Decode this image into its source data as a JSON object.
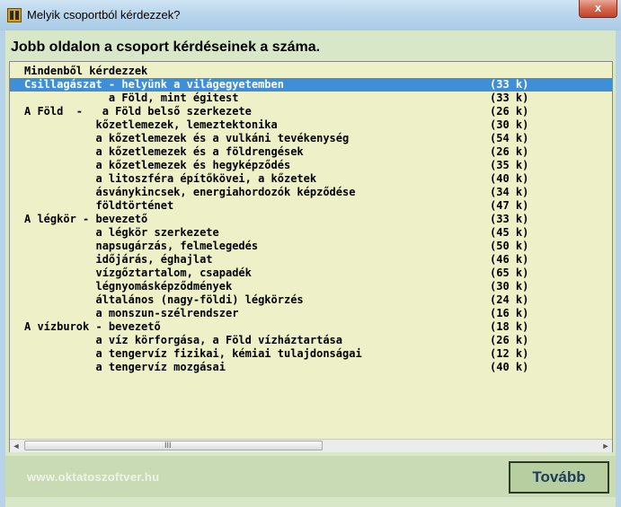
{
  "window": {
    "title": "Melyik csoportból kérdezzek?",
    "close_label": "x"
  },
  "heading": "Jobb oldalon a csoport kérdéseinek a száma.",
  "colors": {
    "selection": "#3f8fd8",
    "list_background": "#eef0c8",
    "client_background": "#d8e7c8"
  },
  "list": {
    "selected_index": 1,
    "rows": [
      {
        "label": "Mindenből kérdezzek",
        "count": ""
      },
      {
        "label": "Csillagászat - helyünk a világegyetemben",
        "count": "(33 k)"
      },
      {
        "label": "             a Föld, mint égitest",
        "count": "(33 k)"
      },
      {
        "label": "A Föld  -   a Föld belső szerkezete",
        "count": "(26 k)"
      },
      {
        "label": "           kőzetlemezek, lemeztektonika",
        "count": "(30 k)"
      },
      {
        "label": "           a kőzetlemezek és a vulkáni tevékenység",
        "count": "(54 k)"
      },
      {
        "label": "           a kőzetlemezek és a földrengések",
        "count": "(26 k)"
      },
      {
        "label": "           a kőzetlemezek és hegyképződés",
        "count": "(35 k)"
      },
      {
        "label": "           a litoszféra építőkövei, a kőzetek",
        "count": "(40 k)"
      },
      {
        "label": "           ásványkincsek, energiahordozók képződése",
        "count": "(34 k)"
      },
      {
        "label": "           földtörténet",
        "count": "(47 k)"
      },
      {
        "label": "A légkör - bevezető",
        "count": "(33 k)"
      },
      {
        "label": "           a légkör szerkezete",
        "count": "(45 k)"
      },
      {
        "label": "           napsugárzás, felmelegedés",
        "count": "(50 k)"
      },
      {
        "label": "           időjárás, éghajlat",
        "count": "(46 k)"
      },
      {
        "label": "           vízgőztartalom, csapadék",
        "count": "(65 k)"
      },
      {
        "label": "           légnyomásképződmények",
        "count": "(30 k)"
      },
      {
        "label": "           általános (nagy-földi) légkörzés",
        "count": "(24 k)"
      },
      {
        "label": "           a monszun-szélrendszer",
        "count": "(16 k)"
      },
      {
        "label": "A vízburok - bevezető",
        "count": "(18 k)"
      },
      {
        "label": "           a víz körforgása, a Föld vízháztartása",
        "count": "(26 k)"
      },
      {
        "label": "           a tengervíz fizikai, kémiai tulajdonságai",
        "count": "(12 k)"
      },
      {
        "label": "           a tengervíz mozgásai",
        "count": "(40 k)"
      }
    ]
  },
  "scrollbar": {
    "left_arrow": "◄",
    "right_arrow": "►",
    "grip": "III"
  },
  "footer": {
    "website": "www.oktatoszoftver.hu",
    "next_button": "Tovább"
  }
}
